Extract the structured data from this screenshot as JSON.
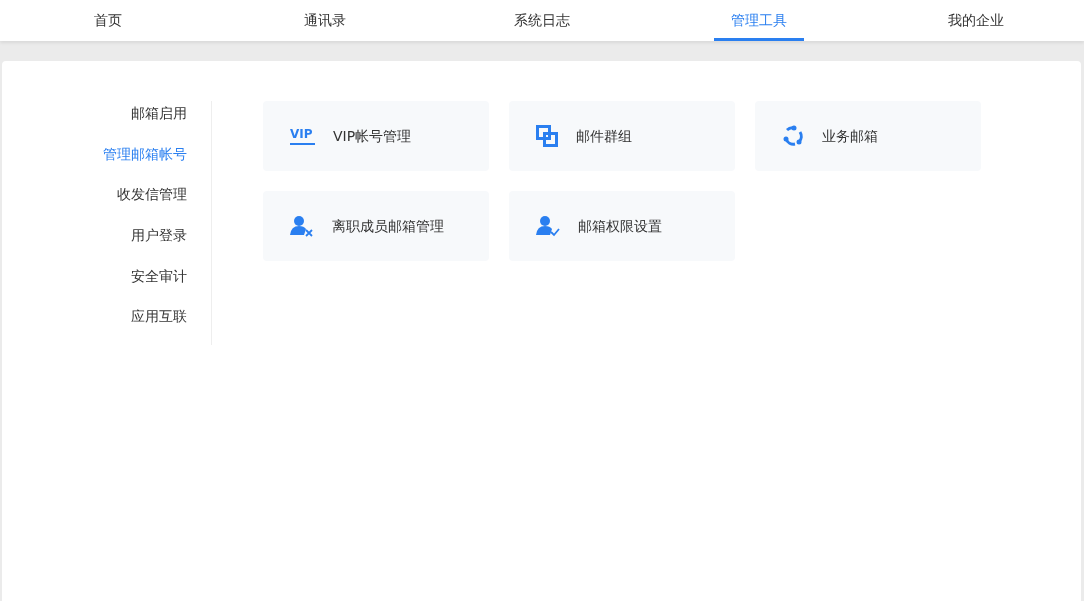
{
  "tabs": [
    {
      "label": "首页",
      "selected": false
    },
    {
      "label": "通讯录",
      "selected": false
    },
    {
      "label": "系统日志",
      "selected": false
    },
    {
      "label": "管理工具",
      "selected": true
    },
    {
      "label": "我的企业",
      "selected": false
    }
  ],
  "sidebar": {
    "items": [
      {
        "label": "邮箱启用",
        "selected": false
      },
      {
        "label": "管理邮箱帐号",
        "selected": true
      },
      {
        "label": "收发信管理",
        "selected": false
      },
      {
        "label": "用户登录",
        "selected": false
      },
      {
        "label": "安全审计",
        "selected": false
      },
      {
        "label": "应用互联",
        "selected": false
      }
    ]
  },
  "tools": [
    {
      "kind": "vip",
      "icon_text": "VIP",
      "label": "VIP帐号管理"
    },
    {
      "kind": "group",
      "label": "邮件群组"
    },
    {
      "kind": "cycle",
      "label": "业务邮箱"
    },
    {
      "kind": "user-remove",
      "label": "离职成员邮箱管理"
    },
    {
      "kind": "user-check",
      "label": "邮箱权限设置"
    }
  ]
}
